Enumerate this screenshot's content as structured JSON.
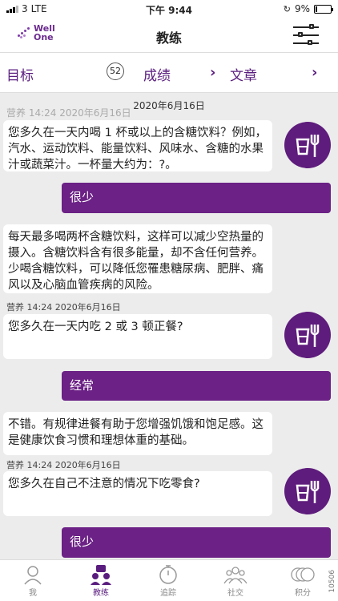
{
  "status_bar": {
    "carrier": "3",
    "network": "LTE",
    "time": "下午 9:44",
    "battery": "9%"
  },
  "header": {
    "logo_line1": "Well",
    "logo_line2": "One",
    "title": "教练"
  },
  "nav": {
    "goal": "目标",
    "badge": "52",
    "score": "成绩",
    "article": "文章"
  },
  "chat": {
    "date_divider": "2020年6月16日",
    "ghost_meta": "营养 14:24 2020年6月16日",
    "messages": [
      {
        "text": "您多久在一天内喝 1 杯或以上的含糖饮料？例如，汽水、运动饮料、能量饮料、风味水、含糖的水果汁或蔬菜汁。一杯量大约为：?。"
      },
      {
        "reply": "很少"
      },
      {
        "text": "每天最多喝两杯含糖饮料，这样可以减少空热量的摄入。含糖饮料含有很多能量，却不含任何营养。少喝含糖饮料，可以降低您罹患糖尿病、肥胖、痛风以及心脑血管疾病的风险。"
      },
      {
        "meta": "营养 14:24 2020年6月16日",
        "text": "您多久在一天内吃 2 或 3 顿正餐?"
      },
      {
        "reply": "经常"
      },
      {
        "text": "不错。有规律进餐有助于您增强饥饿和饱足感。这是健康饮食习惯和理想体重的基础。"
      },
      {
        "meta": "营养 14:24 2020年6月16日",
        "text": "您多久在自己不注意的情况下吃零食?"
      },
      {
        "reply": "很少"
      }
    ]
  },
  "tabs": [
    {
      "label": "我",
      "icon": "person-icon"
    },
    {
      "label": "教练",
      "icon": "coach-icon"
    },
    {
      "label": "追踪",
      "icon": "stopwatch-icon"
    },
    {
      "label": "社交",
      "icon": "group-icon"
    },
    {
      "label": "积分",
      "icon": "coins-icon"
    }
  ],
  "version": "10506",
  "colors": {
    "brand": "#5e1c7c",
    "reply_bubble": "#6b2185"
  }
}
